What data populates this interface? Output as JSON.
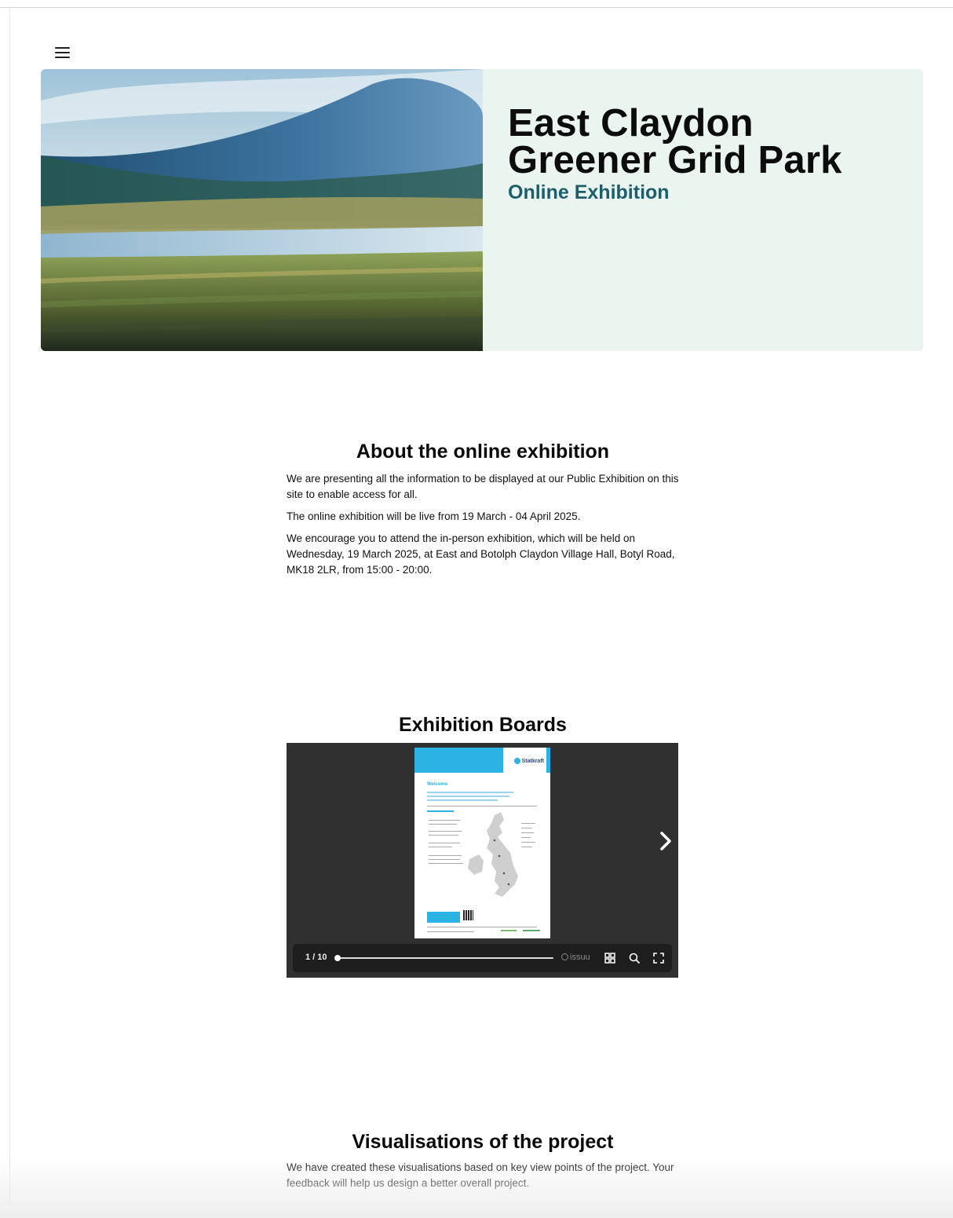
{
  "header": {
    "menu_icon": "hamburger-menu-icon"
  },
  "hero": {
    "title": "East Claydon Greener Grid Park",
    "subtitle": "Online Exhibition",
    "background_color": "#eaf5f0",
    "subtitle_color": "#1c5e6b"
  },
  "about": {
    "heading": "About the online exhibition",
    "paragraphs": [
      "We are presenting all the information to be displayed at our Public Exhibition on this site to enable access for all.",
      "The online exhibition will be live from 19 March - 04 April 2025.",
      "We encourage you to attend the in-person exhibition, which will be held on Wednesday, 19 March 2025, at East and Botolph Claydon Village Hall, Botyl Road, MK18 2LR, from 15:00 - 20:00."
    ]
  },
  "boards": {
    "heading": "Exhibition Boards",
    "viewer": {
      "page_counter": "1 / 10",
      "brand": "issuu",
      "document_brand": "Statkraft",
      "document_heading": "Welcome",
      "progress_fraction": 0.0,
      "icons": [
        "chevron-right-icon",
        "grid-view-icon",
        "search-icon",
        "fullscreen-icon"
      ]
    }
  },
  "visualisations": {
    "heading": "Visualisations of the project",
    "paragraphs": [
      "We have created these visualisations based on key view points of the project. Your feedback will help us design a better overall project."
    ]
  }
}
